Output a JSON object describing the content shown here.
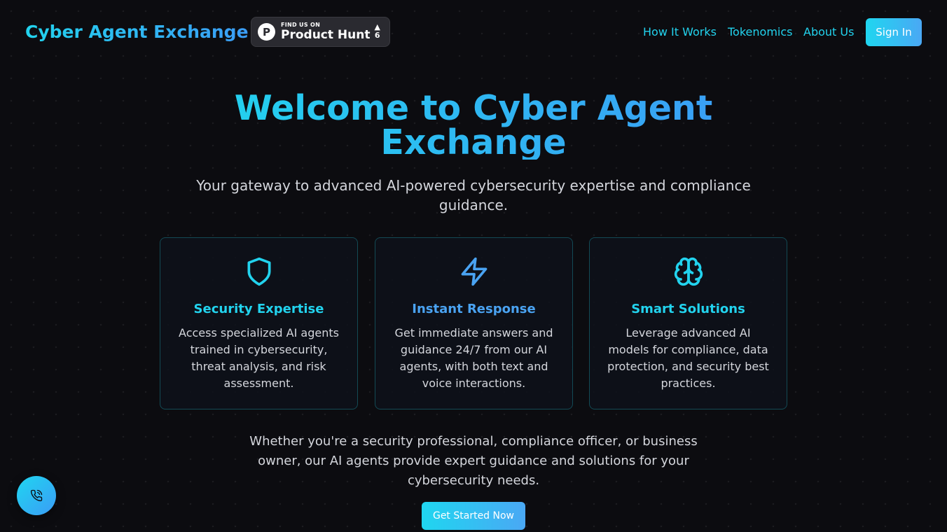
{
  "header": {
    "logo": "Cyber Agent Exchange",
    "product_hunt": {
      "small": "FIND US ON",
      "big": "Product Hunt",
      "count": "6",
      "logo_letter": "P"
    },
    "nav": [
      "How It Works",
      "Tokenomics",
      "About Us"
    ],
    "sign_in": "Sign In"
  },
  "hero": {
    "title": "Welcome to Cyber Agent Exchange",
    "subtitle": "Your gateway to advanced AI-powered cybersecurity expertise and compliance guidance."
  },
  "features": [
    {
      "icon": "shield-icon",
      "title": "Security Expertise",
      "text": "Access specialized AI agents trained in cybersecurity, threat analysis, and risk assessment.",
      "title_color": "#22d3ee"
    },
    {
      "icon": "lightning-icon",
      "title": "Instant Response",
      "text": "Get immediate answers and guidance 24/7 from our AI agents, with both text and voice interactions.",
      "title_color": "#4aa3f2"
    },
    {
      "icon": "brain-icon",
      "title": "Smart Solutions",
      "text": "Leverage advanced AI models for compliance, data protection, and security best practices.",
      "title_color": "#22d3ee"
    }
  ],
  "bottom": {
    "text": "Whether you're a security professional, compliance officer, or business owner, our AI agents provide expert guidance and solutions for your cybersecurity needs.",
    "cta": "Get Started Now"
  },
  "fab": {
    "icon": "phone-icon"
  },
  "colors": {
    "accent_cyan": "#22d3ee",
    "accent_blue": "#3b9cf6",
    "background": "#0c0c10"
  }
}
